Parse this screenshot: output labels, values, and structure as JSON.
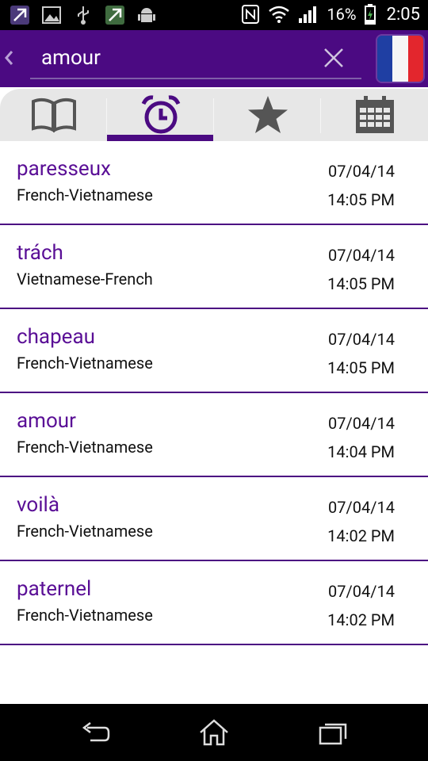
{
  "status": {
    "battery_percent": "16%",
    "time": "2:05"
  },
  "search": {
    "query": "amour"
  },
  "tabs": [
    {
      "name": "dictionary",
      "icon": "book-icon"
    },
    {
      "name": "history",
      "icon": "alarm-clock-icon",
      "active": true
    },
    {
      "name": "favorites",
      "icon": "star-icon"
    },
    {
      "name": "calendar",
      "icon": "calendar-icon"
    }
  ],
  "history": [
    {
      "word": "paresseux",
      "lang": "French-Vietnamese",
      "date": "07/04/14",
      "time": "14:05 PM"
    },
    {
      "word": "trách",
      "lang": "Vietnamese-French",
      "date": "07/04/14",
      "time": "14:05 PM"
    },
    {
      "word": "chapeau",
      "lang": "French-Vietnamese",
      "date": "07/04/14",
      "time": "14:05 PM"
    },
    {
      "word": "amour",
      "lang": "French-Vietnamese",
      "date": "07/04/14",
      "time": "14:04 PM"
    },
    {
      "word": "voilà",
      "lang": "French-Vietnamese",
      "date": "07/04/14",
      "time": "14:02 PM"
    },
    {
      "word": "paternel",
      "lang": "French-Vietnamese",
      "date": "07/04/14",
      "time": "14:02 PM"
    }
  ],
  "colors": {
    "accent": "#4b0a82",
    "word": "#5a0f96"
  }
}
